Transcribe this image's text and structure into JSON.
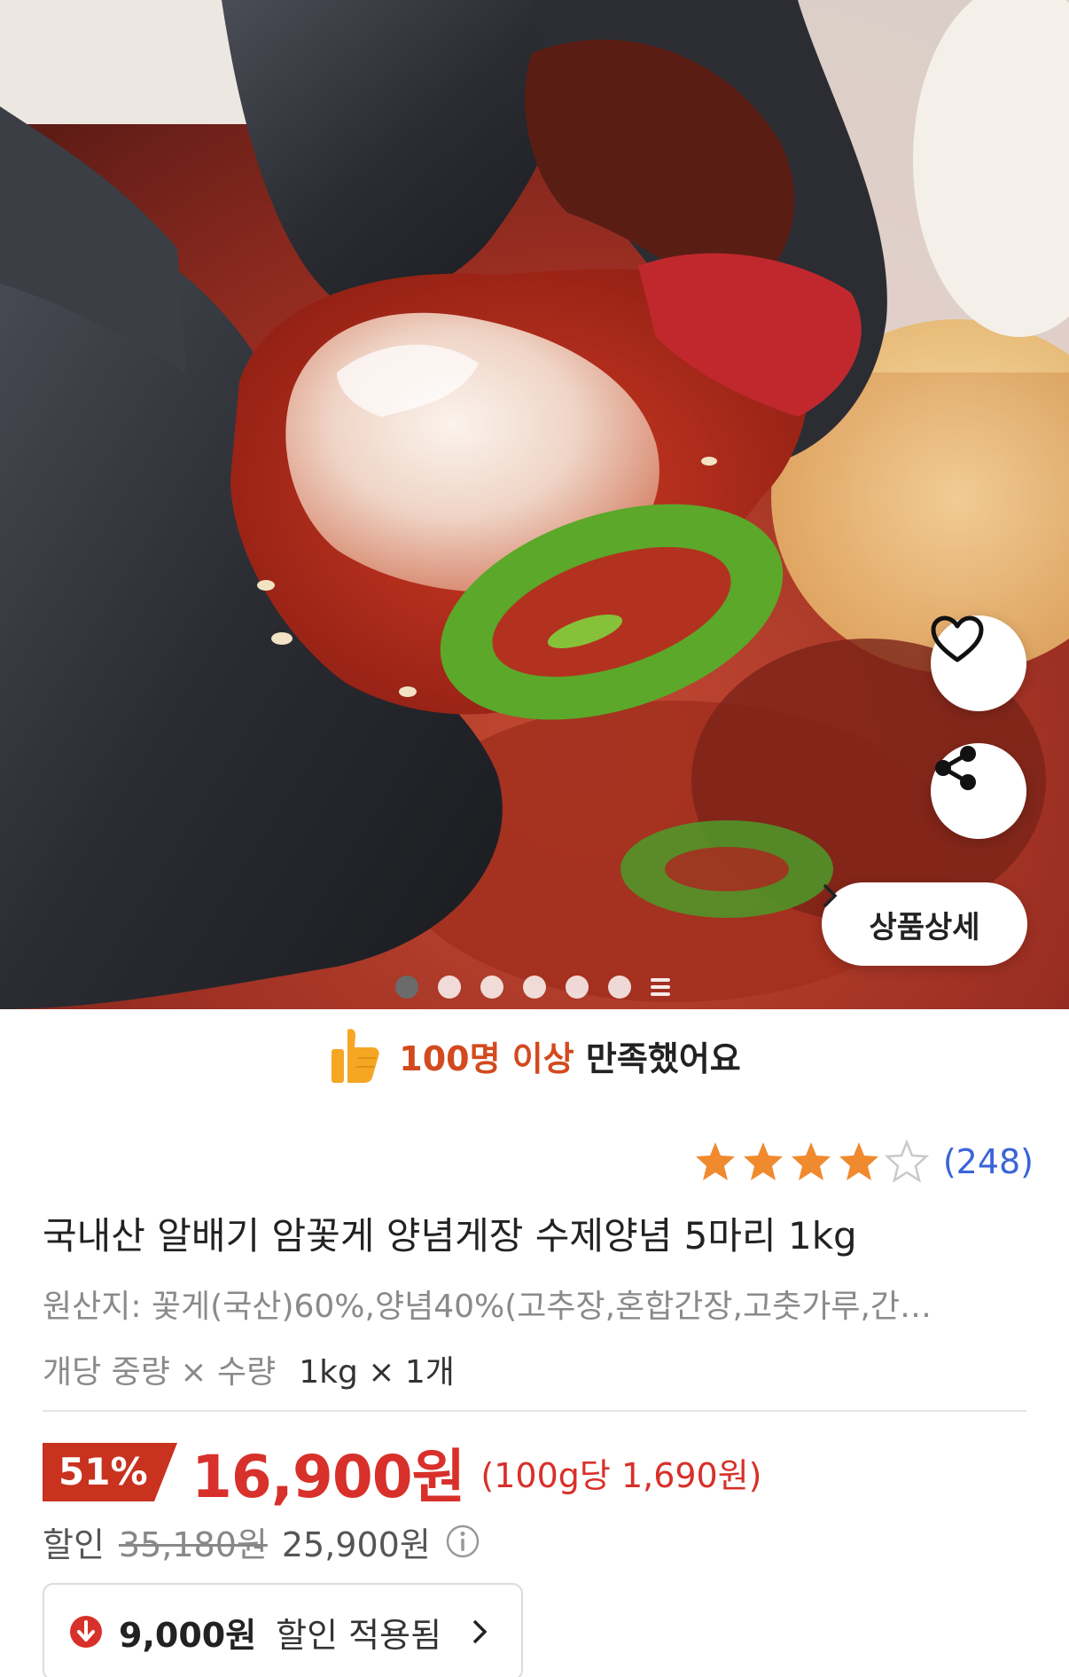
{
  "gallery": {
    "page_count": 6,
    "active_index": 0
  },
  "actions": {
    "like_icon": "heart-icon",
    "share_icon": "share-icon",
    "detail_label": "상품상세"
  },
  "satisfaction": {
    "highlight": "100명 이상",
    "rest": " 만족했어요"
  },
  "rating": {
    "stars": 4,
    "max": 5,
    "review_count": "(248)"
  },
  "product": {
    "title": "국내산 알배기 암꽃게 양념게장 수제양념 5마리 1kg",
    "origin": "원산지: 꽃게(국산)60%,양념40%(고추장,혼합간장,고춧가루,간…",
    "qty_label": "개당 중량 × 수량",
    "qty_value": "1kg × 1개"
  },
  "price": {
    "discount_rate": "51%",
    "sale_price": "16,900원",
    "unit_price": "(100g당 1,690원)",
    "discount_label": "할인",
    "original_price": "35,180원",
    "discounted_price": "25,900원"
  },
  "coupon": {
    "amount": "9,000원",
    "text": "할인 적용됨"
  },
  "colors": {
    "accent_red": "#d8302a",
    "badge_red": "#c8321f",
    "highlight_orange": "#d24a1e",
    "star": "#f08a2e",
    "link_blue": "#3a64d8"
  }
}
